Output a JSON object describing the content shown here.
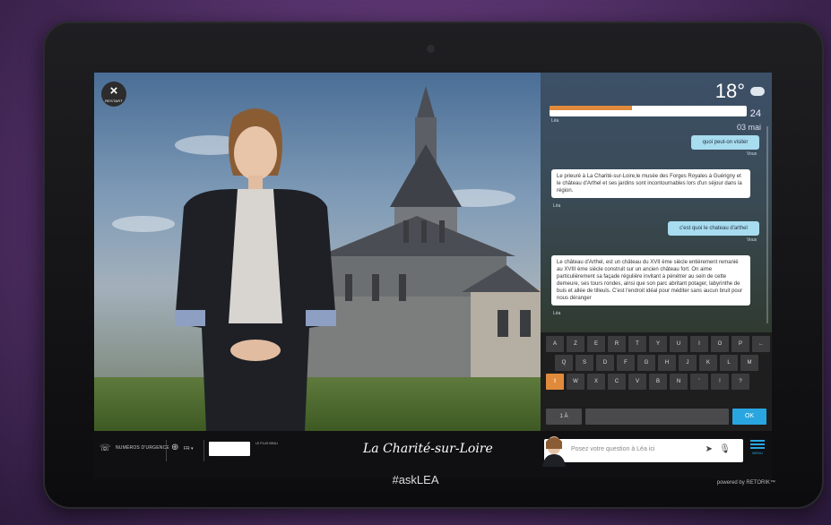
{
  "header_text": "",
  "close": {
    "label": "×",
    "sub": "RESTART"
  },
  "weather": {
    "temperature": "18°",
    "date_day": "24",
    "date_month": "03 mai"
  },
  "chat": {
    "progress_fraction": 0.42,
    "messages": [
      {
        "from": "lea",
        "speaker": "Léa",
        "text": ""
      },
      {
        "from": "user",
        "speaker": "Vous",
        "text": "quoi peut-on visiter"
      },
      {
        "from": "lea",
        "speaker": "Léa",
        "text": "Le prieuré à La Charité-sur-Loire,le musée des Forges Royales à Guérigny et le château d'Arthel et ses jardins sont incontournables lors d'un séjour dans la région."
      },
      {
        "from": "user",
        "speaker": "Vous",
        "text": "c'est quoi le chateau d'arthel"
      },
      {
        "from": "lea",
        "speaker": "Léa",
        "text": "Le château d'Arthel, est un château du XVII ème siècle entièrement remanié au XVIII ème siècle construit sur un ancien château fort. On aime particulièrement sa façade régulière invitant à pénétrer au sein de cette demeure, ses tours rondes, ainsi que son parc abritant potager, labyrinthe de buis et allée de tilleuls. C'est l'endroit idéal pour méditer sans aucun bruit pour nous déranger"
      }
    ]
  },
  "keyboard": {
    "row1": [
      "A",
      "Z",
      "E",
      "R",
      "T",
      "Y",
      "U",
      "I",
      "O",
      "P",
      "←"
    ],
    "row2": [
      "Q",
      "S",
      "D",
      "F",
      "G",
      "H",
      "J",
      "K",
      "L",
      "M"
    ],
    "row3": [
      "⇧",
      "W",
      "X",
      "C",
      "V",
      "B",
      "N",
      "'",
      "!",
      "?"
    ],
    "row4_left": "1 À",
    "ok": "OK"
  },
  "bottom": {
    "phone_icon": "☏",
    "emergency": "NUMÉROS D'URGENCE",
    "globe_icon": "⊕",
    "lang": "FR ▾",
    "logo_text": "",
    "slogan": "LE PLUS BEAU ",
    "title": "La Charité-sur-Loire",
    "input_placeholder": "Posez votre question à Léa ici",
    "send_icon": "➤",
    "mic_icon": "🎙",
    "menu_label": "MENU"
  },
  "hashtag": "#askLEA",
  "powered_by": "powered by RETORIK™",
  "colors": {
    "accent_blue": "#29a6e0",
    "accent_orange": "#e08a3c",
    "user_bubble": "#a8dcef"
  }
}
